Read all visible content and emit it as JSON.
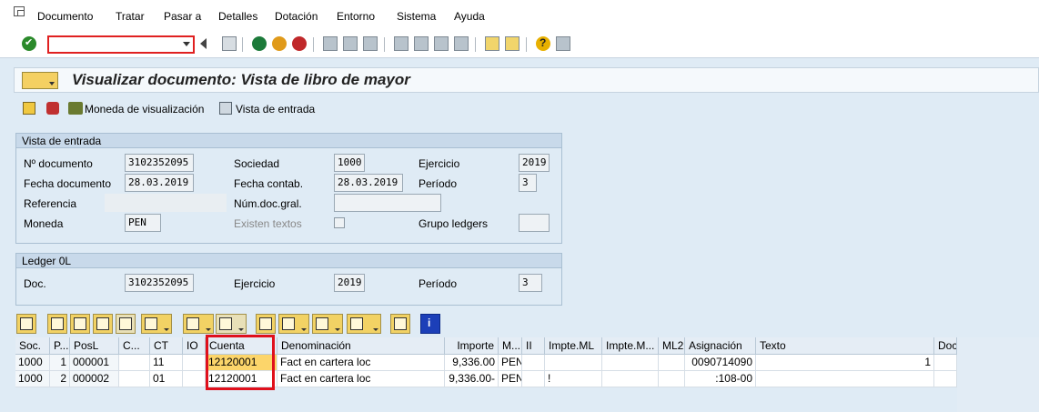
{
  "menu": {
    "items": [
      "Documento",
      "Tratar",
      "Pasar a",
      "Detalles",
      "Dotación",
      "Entorno",
      "Sistema",
      "Ayuda"
    ]
  },
  "toolbar": {
    "command_field_value": ""
  },
  "title": "Visualizar documento: Vista de libro de mayor",
  "app_toolbar": {
    "currency_button": "Moneda de visualización",
    "entry_view_button": "Vista de entrada"
  },
  "entry_view": {
    "title": "Vista de entrada",
    "doc_number_label": "Nº documento",
    "doc_number": "3102352095",
    "company_label": "Sociedad",
    "company": "1000",
    "fiscal_year_label": "Ejercicio",
    "fiscal_year": "2019",
    "doc_date_label": "Fecha documento",
    "doc_date": "28.03.2019",
    "posting_date_label": "Fecha contab.",
    "posting_date": "28.03.2019",
    "period_label": "Período",
    "period": "3",
    "reference_label": "Referencia",
    "reference": "",
    "cross_doc_label": "Núm.doc.gral.",
    "cross_doc": "",
    "currency_label": "Moneda",
    "currency": "PEN",
    "texts_exist_label": "Existen textos",
    "ledger_group_label": "Grupo ledgers",
    "ledger_group": ""
  },
  "ledger": {
    "title": "Ledger 0L",
    "doc_label": "Doc.",
    "doc": "3102352095",
    "fiscal_year_label": "Ejercicio",
    "fiscal_year": "2019",
    "period_label": "Período",
    "period": "3"
  },
  "grid": {
    "columns": [
      "Soc.",
      "P...",
      "PosL",
      "C...",
      "CT",
      "IO",
      "Cuenta",
      "Denominación",
      "Importe",
      "M...",
      "II",
      "Impte.ML",
      "Impte.M...",
      "ML2",
      "Asignación",
      "Texto",
      "Doc"
    ],
    "rows": [
      {
        "soc": "1000",
        "p": "1",
        "posl": "000001",
        "c": "",
        "ct": "11",
        "io": "",
        "cuenta": "12120001",
        "denominacion": "Fact en cartera loc",
        "importe": "9,336.00",
        "m": "PEN",
        "ii": "",
        "impte_ml": "",
        "impte_m": "",
        "ml2": "",
        "asignacion": "0090714090",
        "texto": "1",
        "doc": ""
      },
      {
        "soc": "1000",
        "p": "2",
        "posl": "000002",
        "c": "",
        "ct": "01",
        "io": "",
        "cuenta": "12120001",
        "denominacion": "Fact en cartera loc",
        "importe": "9,336.00-",
        "m": "PEN",
        "ii": "",
        "impte_ml": "!",
        "impte_m": "",
        "ml2": "",
        "asignacion": ":108-00",
        "texto": "",
        "doc": ""
      }
    ]
  }
}
